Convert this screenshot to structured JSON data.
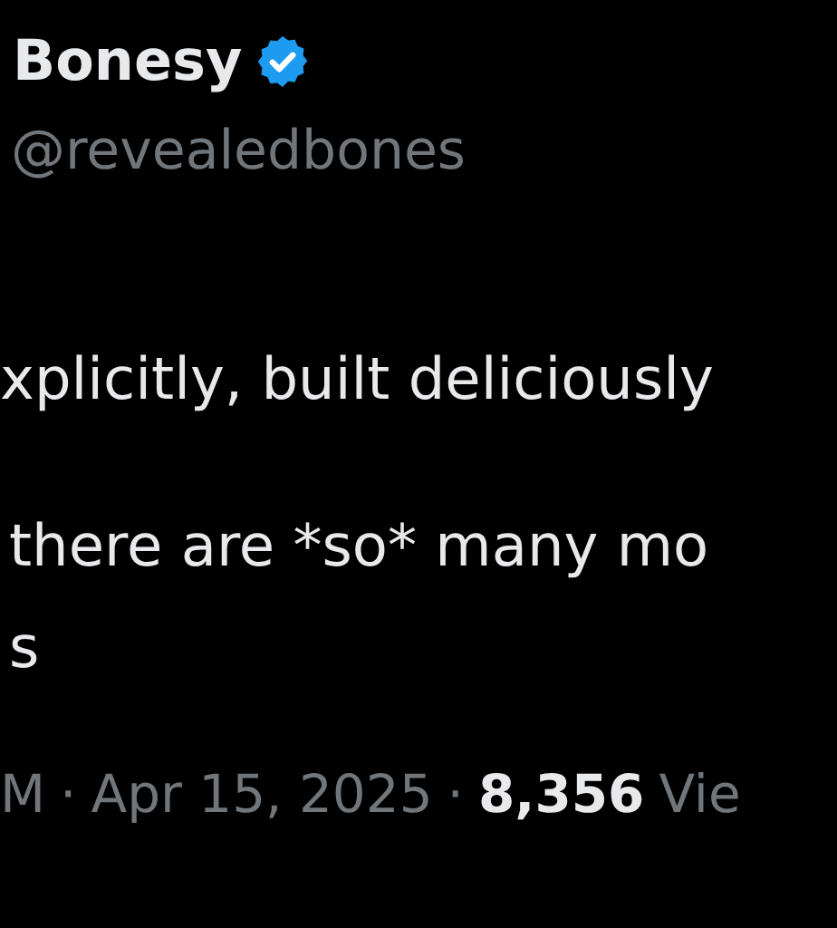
{
  "author": {
    "name": "Bonesy",
    "verified": true,
    "handle": "@revealedbones"
  },
  "body": [
    {
      "lines": [
        "xplicitly, built deliciously"
      ]
    },
    {
      "lines": [
        "there are *so* many mo",
        "s"
      ]
    }
  ],
  "meta": {
    "time": "M",
    "separator_1": "·",
    "date": "Apr 15, 2025",
    "separator_2": "·",
    "views_count": "8,356",
    "views_label": "Vie"
  }
}
